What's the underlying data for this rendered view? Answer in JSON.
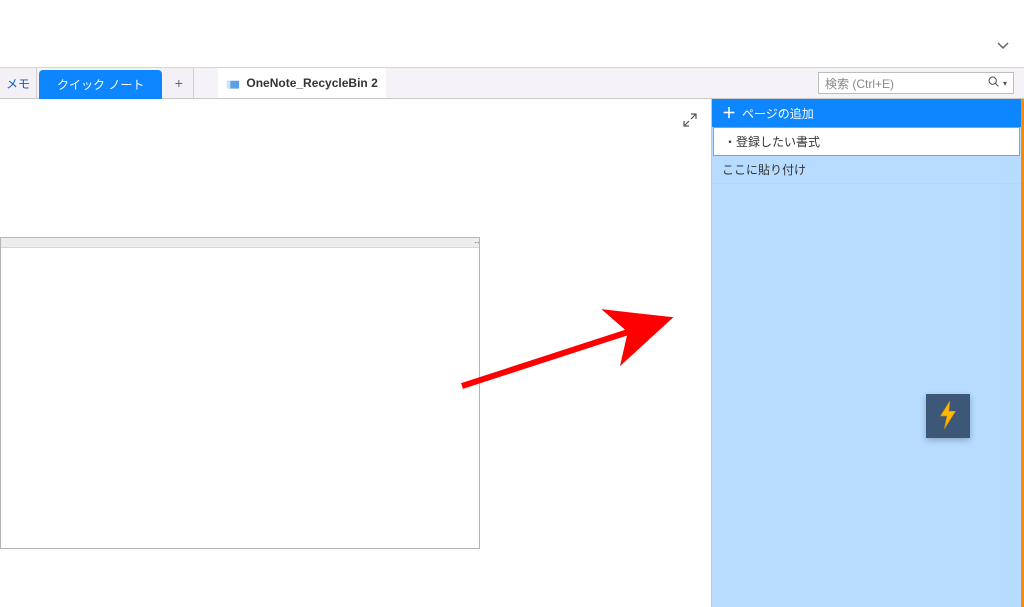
{
  "tabs": {
    "memo": "メモ",
    "active": "クイック ノート",
    "add_tooltip": "+",
    "notebook": "OneNote_RecycleBin 2"
  },
  "search": {
    "placeholder": "検索 (Ctrl+E)"
  },
  "page_panel": {
    "add_label": "ページの追加",
    "items": [
      "・登録したい書式",
      "ここに貼り付け"
    ]
  },
  "icons": {
    "chevron_down": "chevron-down-icon",
    "expand": "expand-icon",
    "search": "search-icon",
    "plus": "plus-icon",
    "lightning": "lightning-icon",
    "notebook": "notebook-icon"
  }
}
